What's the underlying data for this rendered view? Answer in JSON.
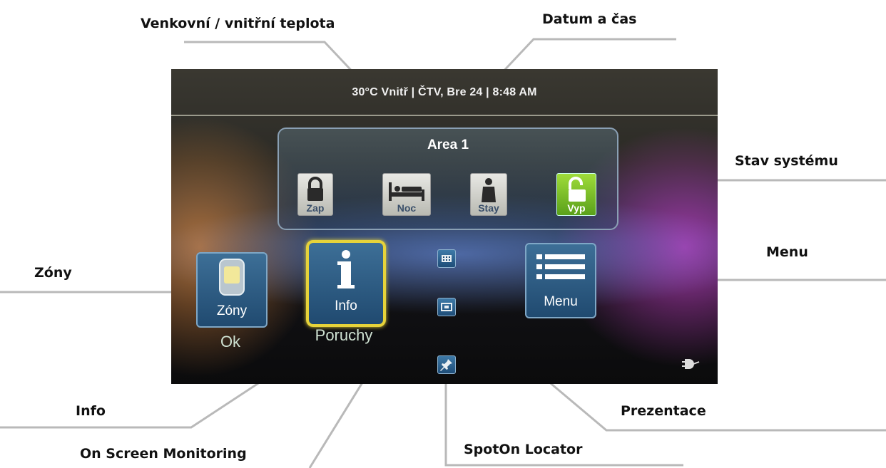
{
  "callouts": {
    "temperature": "Venkovní / vnitřní teplota",
    "datetime": "Datum a čas",
    "system_state": "Stav systému",
    "zones": "Zóny",
    "menu": "Menu",
    "info": "Info",
    "presentation": "Prezentace",
    "on_screen_monitoring": "On Screen Monitoring",
    "spoton_locator": "SpotOn Locator"
  },
  "screen": {
    "status_bar": "30°C Vnitř | ČTV, Bre 24 |  8:48 AM",
    "area": {
      "title": "Area 1",
      "modes": [
        {
          "label": "Zap",
          "icon": "lock-icon"
        },
        {
          "label": "Noc",
          "icon": "bed-icon"
        },
        {
          "label": "Stay",
          "icon": "person-icon"
        },
        {
          "label": "Vyp",
          "icon": "unlock-icon",
          "active": true
        }
      ]
    },
    "zones_button": {
      "label": "Zóny",
      "status": "Ok",
      "icon": "keypad-device-icon"
    },
    "info_button": {
      "label": "Info",
      "status": "Poruchy",
      "icon": "info-icon"
    },
    "menu_button": {
      "label": "Menu",
      "icon": "list-icon"
    },
    "small_icons": [
      "keypad-icon",
      "slideshow-icon",
      "pin-icon"
    ],
    "power_icon": "power-plug-icon",
    "colors": {
      "active_mode": "#7cc52a",
      "button_blue": "#2f5f88",
      "info_highlight": "#e6d33a"
    }
  }
}
